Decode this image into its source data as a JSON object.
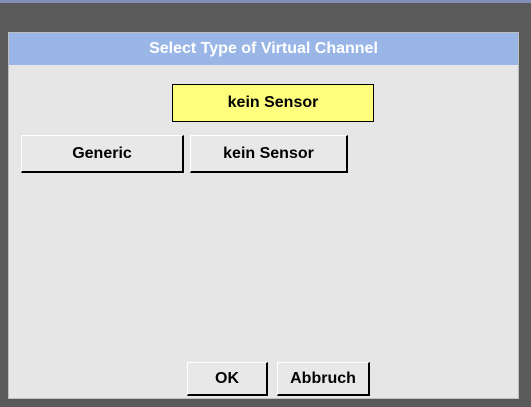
{
  "dialog": {
    "title": "Select Type of Virtual Channel",
    "current_selection": "kein Sensor",
    "options": [
      {
        "label": "Generic"
      },
      {
        "label": "kein Sensor"
      }
    ],
    "ok_label": "OK",
    "cancel_label": "Abbruch"
  },
  "colors": {
    "title_bar": "#9ab6e6",
    "selection_box": "#ffff7d",
    "dialog_background": "#e6e6e6"
  }
}
